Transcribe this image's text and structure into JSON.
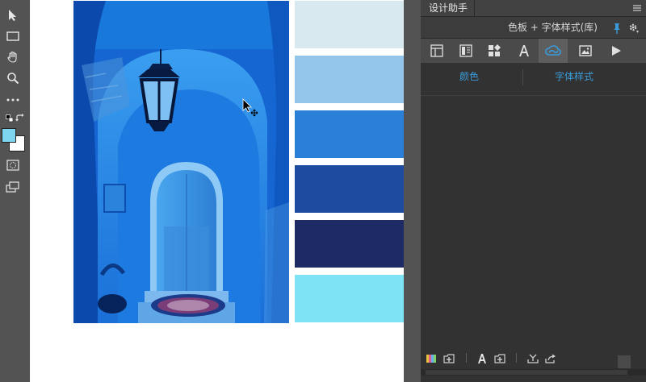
{
  "panel": {
    "tab_label": "设计助手",
    "subtitle": "色板 + 字体样式(库)",
    "links": [
      {
        "label": "颜色"
      },
      {
        "label": "字体样式"
      }
    ]
  },
  "swatches": [
    {
      "color": "#d8eaef"
    },
    {
      "color": "#93c4ea"
    },
    {
      "color": "#2a7fd6"
    },
    {
      "color": "#1e4aa0"
    },
    {
      "color": "#1e2a64"
    },
    {
      "color": "#7ee3f4"
    }
  ],
  "toolbar": {
    "foreground_color": "#7dd5f0",
    "background_color": "#ffffff"
  },
  "colors": {
    "accent": "#3a9bd8",
    "panel_bg": "#323232",
    "app_bg": "#535353"
  }
}
